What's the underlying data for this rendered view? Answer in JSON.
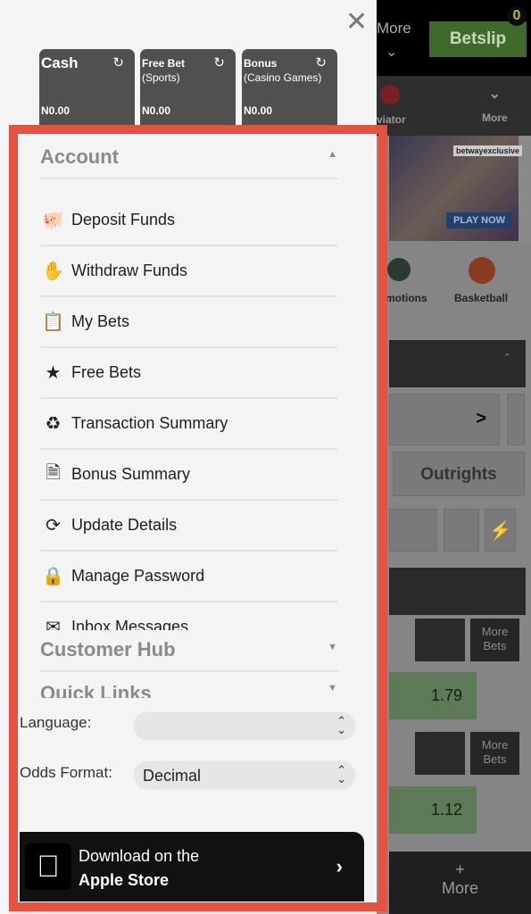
{
  "background": {
    "more_label": "More",
    "betslip_label": "Betslip",
    "betslip_count": "0",
    "nav": [
      "viator",
      "More"
    ],
    "banner": {
      "tag": "betwayexclusive",
      "cta": "PLAY NOW"
    },
    "categories": [
      "motions",
      "Basketball"
    ],
    "tabs": {
      "outrights": "Outrights"
    },
    "odds": [
      "1.79",
      "1.12"
    ],
    "more_bets": "More Bets",
    "bottom_more": "More",
    "bottom_plus": "+"
  },
  "drawer": {
    "wallets": [
      {
        "title": "Cash",
        "subtitle": "",
        "amount": "N0.00"
      },
      {
        "title": "Free Bet",
        "subtitle": "(Sports)",
        "amount": "N0.00"
      },
      {
        "title": "Bonus",
        "subtitle": "(Casino Games)",
        "amount": "N0.00"
      }
    ],
    "account_title": "Account",
    "items": [
      {
        "label": "Deposit Funds",
        "icon": "piggy-bank-icon"
      },
      {
        "label": "Withdraw Funds",
        "icon": "withdraw-hand-icon"
      },
      {
        "label": "My Bets",
        "icon": "betslip-icon"
      },
      {
        "label": "Free Bets",
        "icon": "star-icon"
      },
      {
        "label": "Transaction Summary",
        "icon": "transaction-icon"
      },
      {
        "label": "Bonus Summary",
        "icon": "document-icon"
      },
      {
        "label": "Update Details",
        "icon": "sync-icon"
      },
      {
        "label": "Manage Password",
        "icon": "lock-icon"
      },
      {
        "label": "Inbox Messages",
        "icon": "envelope-icon"
      }
    ],
    "customer_hub": "Customer Hub",
    "quick_links": "Quick Links",
    "language_label": "Language:",
    "language_value": "",
    "odds_label": "Odds Format:",
    "odds_value": "Decimal",
    "app": {
      "line1": "Download on the",
      "line2": "Apple Store"
    }
  },
  "colors": {
    "highlight": "#e8503f",
    "betslip": "#3e6b2c",
    "wallet": "#505050"
  }
}
